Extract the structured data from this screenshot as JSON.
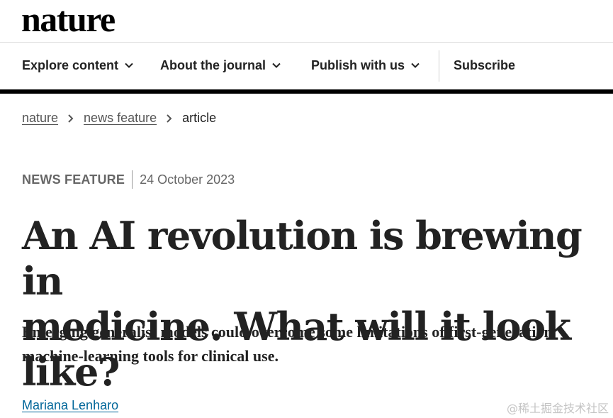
{
  "brand": {
    "logo_text": "nature"
  },
  "nav": {
    "items": [
      {
        "label": "Explore content",
        "has_dropdown": true
      },
      {
        "label": "About the journal",
        "has_dropdown": true
      },
      {
        "label": "Publish with us",
        "has_dropdown": true
      }
    ],
    "subscribe_label": "Subscribe"
  },
  "breadcrumb": {
    "items": [
      {
        "label": "nature",
        "link": true
      },
      {
        "label": "news feature",
        "link": true
      },
      {
        "label": "article",
        "link": false
      }
    ]
  },
  "article": {
    "type": "NEWS FEATURE",
    "date": "24 October 2023",
    "title_line1": "An AI revolution is brewing in",
    "title_line2": "medicine. What will it look like?",
    "standfirst_line1": "Emerging generalist models could overcome some limitations of first-generation",
    "standfirst_line2": "machine-learning tools for clinical use.",
    "author": "Mariana Lenharo"
  },
  "watermark": {
    "text": "@稀土掘金技术社区"
  },
  "colors": {
    "link": "#006699",
    "rule": "#000000",
    "text": "#222222",
    "muted": "#666666"
  }
}
